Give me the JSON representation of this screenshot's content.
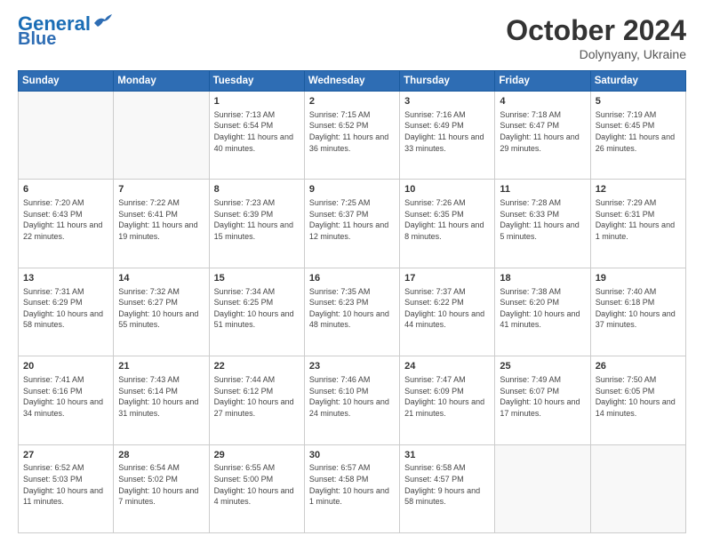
{
  "header": {
    "logo_line1": "General",
    "logo_line2": "Blue",
    "month": "October 2024",
    "location": "Dolynyany, Ukraine"
  },
  "days_of_week": [
    "Sunday",
    "Monday",
    "Tuesday",
    "Wednesday",
    "Thursday",
    "Friday",
    "Saturday"
  ],
  "weeks": [
    [
      {
        "day": "",
        "info": ""
      },
      {
        "day": "",
        "info": ""
      },
      {
        "day": "1",
        "info": "Sunrise: 7:13 AM\nSunset: 6:54 PM\nDaylight: 11 hours and 40 minutes."
      },
      {
        "day": "2",
        "info": "Sunrise: 7:15 AM\nSunset: 6:52 PM\nDaylight: 11 hours and 36 minutes."
      },
      {
        "day": "3",
        "info": "Sunrise: 7:16 AM\nSunset: 6:49 PM\nDaylight: 11 hours and 33 minutes."
      },
      {
        "day": "4",
        "info": "Sunrise: 7:18 AM\nSunset: 6:47 PM\nDaylight: 11 hours and 29 minutes."
      },
      {
        "day": "5",
        "info": "Sunrise: 7:19 AM\nSunset: 6:45 PM\nDaylight: 11 hours and 26 minutes."
      }
    ],
    [
      {
        "day": "6",
        "info": "Sunrise: 7:20 AM\nSunset: 6:43 PM\nDaylight: 11 hours and 22 minutes."
      },
      {
        "day": "7",
        "info": "Sunrise: 7:22 AM\nSunset: 6:41 PM\nDaylight: 11 hours and 19 minutes."
      },
      {
        "day": "8",
        "info": "Sunrise: 7:23 AM\nSunset: 6:39 PM\nDaylight: 11 hours and 15 minutes."
      },
      {
        "day": "9",
        "info": "Sunrise: 7:25 AM\nSunset: 6:37 PM\nDaylight: 11 hours and 12 minutes."
      },
      {
        "day": "10",
        "info": "Sunrise: 7:26 AM\nSunset: 6:35 PM\nDaylight: 11 hours and 8 minutes."
      },
      {
        "day": "11",
        "info": "Sunrise: 7:28 AM\nSunset: 6:33 PM\nDaylight: 11 hours and 5 minutes."
      },
      {
        "day": "12",
        "info": "Sunrise: 7:29 AM\nSunset: 6:31 PM\nDaylight: 11 hours and 1 minute."
      }
    ],
    [
      {
        "day": "13",
        "info": "Sunrise: 7:31 AM\nSunset: 6:29 PM\nDaylight: 10 hours and 58 minutes."
      },
      {
        "day": "14",
        "info": "Sunrise: 7:32 AM\nSunset: 6:27 PM\nDaylight: 10 hours and 55 minutes."
      },
      {
        "day": "15",
        "info": "Sunrise: 7:34 AM\nSunset: 6:25 PM\nDaylight: 10 hours and 51 minutes."
      },
      {
        "day": "16",
        "info": "Sunrise: 7:35 AM\nSunset: 6:23 PM\nDaylight: 10 hours and 48 minutes."
      },
      {
        "day": "17",
        "info": "Sunrise: 7:37 AM\nSunset: 6:22 PM\nDaylight: 10 hours and 44 minutes."
      },
      {
        "day": "18",
        "info": "Sunrise: 7:38 AM\nSunset: 6:20 PM\nDaylight: 10 hours and 41 minutes."
      },
      {
        "day": "19",
        "info": "Sunrise: 7:40 AM\nSunset: 6:18 PM\nDaylight: 10 hours and 37 minutes."
      }
    ],
    [
      {
        "day": "20",
        "info": "Sunrise: 7:41 AM\nSunset: 6:16 PM\nDaylight: 10 hours and 34 minutes."
      },
      {
        "day": "21",
        "info": "Sunrise: 7:43 AM\nSunset: 6:14 PM\nDaylight: 10 hours and 31 minutes."
      },
      {
        "day": "22",
        "info": "Sunrise: 7:44 AM\nSunset: 6:12 PM\nDaylight: 10 hours and 27 minutes."
      },
      {
        "day": "23",
        "info": "Sunrise: 7:46 AM\nSunset: 6:10 PM\nDaylight: 10 hours and 24 minutes."
      },
      {
        "day": "24",
        "info": "Sunrise: 7:47 AM\nSunset: 6:09 PM\nDaylight: 10 hours and 21 minutes."
      },
      {
        "day": "25",
        "info": "Sunrise: 7:49 AM\nSunset: 6:07 PM\nDaylight: 10 hours and 17 minutes."
      },
      {
        "day": "26",
        "info": "Sunrise: 7:50 AM\nSunset: 6:05 PM\nDaylight: 10 hours and 14 minutes."
      }
    ],
    [
      {
        "day": "27",
        "info": "Sunrise: 6:52 AM\nSunset: 5:03 PM\nDaylight: 10 hours and 11 minutes."
      },
      {
        "day": "28",
        "info": "Sunrise: 6:54 AM\nSunset: 5:02 PM\nDaylight: 10 hours and 7 minutes."
      },
      {
        "day": "29",
        "info": "Sunrise: 6:55 AM\nSunset: 5:00 PM\nDaylight: 10 hours and 4 minutes."
      },
      {
        "day": "30",
        "info": "Sunrise: 6:57 AM\nSunset: 4:58 PM\nDaylight: 10 hours and 1 minute."
      },
      {
        "day": "31",
        "info": "Sunrise: 6:58 AM\nSunset: 4:57 PM\nDaylight: 9 hours and 58 minutes."
      },
      {
        "day": "",
        "info": ""
      },
      {
        "day": "",
        "info": ""
      }
    ]
  ]
}
